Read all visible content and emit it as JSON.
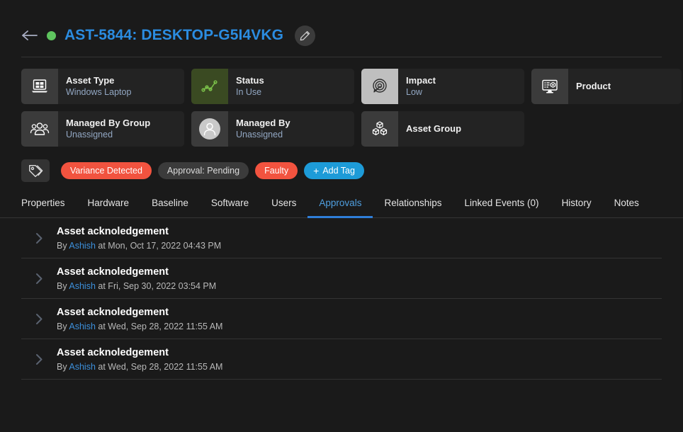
{
  "header": {
    "back_icon": "arrow-left-icon",
    "status_dot": "online-status-dot",
    "title": "AST-5844: DESKTOP-G5I4VKG",
    "edit_icon": "pencil-icon",
    "title_color": "#2b8ce0",
    "status_color": "#5ec45e"
  },
  "cards": {
    "row1": [
      {
        "icon": "laptop-icon",
        "label": "Asset Type",
        "value": "Windows Laptop",
        "icon_style": "default"
      },
      {
        "icon": "line-chart-icon",
        "label": "Status",
        "value": "In Use",
        "icon_style": "green"
      },
      {
        "icon": "target-arrow-icon",
        "label": "Impact",
        "value": "Low",
        "icon_style": "light"
      },
      {
        "icon": "product-monitor-icon",
        "label": "Product",
        "value": "",
        "icon_style": "default"
      }
    ],
    "row2": [
      {
        "icon": "people-group-icon",
        "label": "Managed By Group",
        "value": "Unassigned",
        "icon_style": "default"
      },
      {
        "icon": "user-avatar-icon",
        "label": "Managed By",
        "value": "Unassigned",
        "icon_style": "default"
      },
      {
        "icon": "cubes-icon",
        "label": "Asset Group",
        "value": "",
        "icon_style": "default"
      }
    ]
  },
  "tags": {
    "icon": "tag-icon",
    "items": [
      {
        "label": "Variance Detected",
        "style": "red"
      },
      {
        "label": "Approval: Pending",
        "style": "gray"
      },
      {
        "label": "Faulty",
        "style": "red"
      }
    ],
    "add_tag": {
      "label": "Add Tag",
      "plus": "+"
    },
    "red_color": "#f2533f",
    "blue_color": "#1d9bd8"
  },
  "tabs": {
    "active": "Approvals",
    "items": [
      {
        "label": "Properties"
      },
      {
        "label": "Hardware"
      },
      {
        "label": "Baseline"
      },
      {
        "label": "Software"
      },
      {
        "label": "Users"
      },
      {
        "label": "Approvals"
      },
      {
        "label": "Relationships"
      },
      {
        "label": "Linked Events (0)"
      },
      {
        "label": "History"
      },
      {
        "label": "Notes"
      }
    ],
    "accent_color": "#2f7ed8"
  },
  "approvals": [
    {
      "chevron": "chevron-right-icon",
      "title": "Asset acknoledgement",
      "by_prefix": "By",
      "author": "Ashish",
      "at_text": "at Mon, Oct 17, 2022 04:43 PM"
    },
    {
      "chevron": "chevron-right-icon",
      "title": "Asset acknoledgement",
      "by_prefix": "By",
      "author": "Ashish",
      "at_text": "at Fri, Sep 30, 2022 03:54 PM"
    },
    {
      "chevron": "chevron-right-icon",
      "title": "Asset acknoledgement",
      "by_prefix": "By",
      "author": "Ashish",
      "at_text": "at Wed, Sep 28, 2022 11:55 AM"
    },
    {
      "chevron": "chevron-right-icon",
      "title": "Asset acknoledgement",
      "by_prefix": "By",
      "author": "Ashish",
      "at_text": "at Wed, Sep 28, 2022 11:55 AM"
    }
  ]
}
